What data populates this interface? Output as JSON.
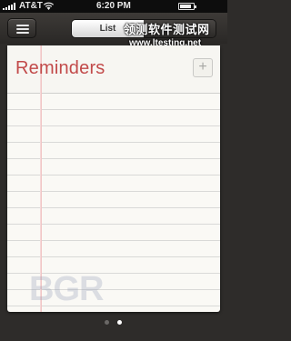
{
  "status_bar": {
    "carrier": "AT&T",
    "time": "6:20 PM",
    "battery_level": 0.85
  },
  "navbar": {
    "segments": [
      {
        "label": "List",
        "active": true
      },
      {
        "label": "",
        "active": false
      }
    ]
  },
  "watermark": {
    "chinese_text": "领测软件测试网",
    "url_text": "www.ltesting.net",
    "logo_text": "BGR"
  },
  "reminders": {
    "title": "Reminders",
    "add_label": "+",
    "items": []
  },
  "page_control": {
    "pages": 2,
    "current": 2
  },
  "colors": {
    "title_red": "#c24a4a",
    "paper": "#faf9f5",
    "leather": "#2e2c2a"
  }
}
